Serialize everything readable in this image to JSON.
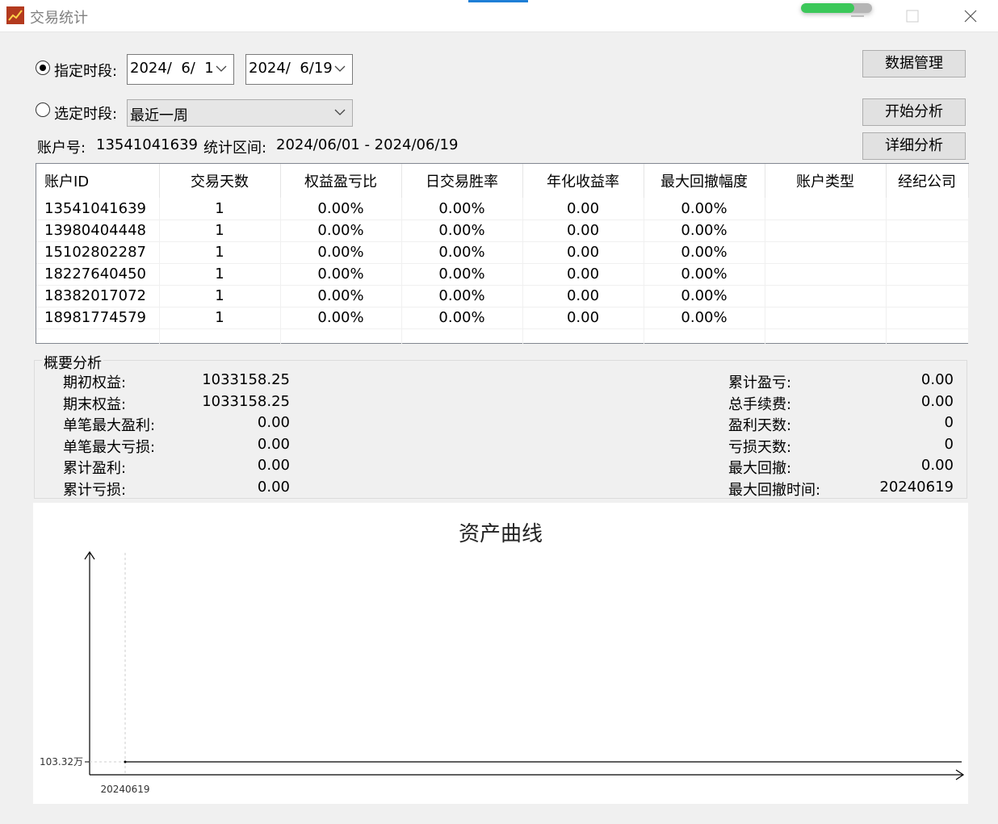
{
  "window": {
    "title": "交易统计",
    "progress_fraction": 0.75,
    "accent_color": "#3cc85a"
  },
  "period": {
    "specified_label": "指定时段:",
    "specified_checked": true,
    "start_date": "2024/  6/  1",
    "end_date": "2024/  6/19",
    "select_label": "选定时段:",
    "select_checked": false,
    "select_value": "最近一周"
  },
  "buttons": {
    "data_manage": "数据管理",
    "start_analysis": "开始分析",
    "detail_analysis": "详细分析"
  },
  "info": {
    "account_label": "账户号:",
    "account_value": "13541041639",
    "range_label": "统计区间:",
    "range_value": "2024/06/01 - 2024/06/19"
  },
  "table": {
    "headers": [
      "账户ID",
      "交易天数",
      "权益盈亏比",
      "日交易胜率",
      "年化收益率",
      "最大回撤幅度",
      "账户类型",
      "经纪公司"
    ],
    "rows": [
      [
        "13541041639",
        "1",
        "0.00%",
        "0.00%",
        "0.00",
        "0.00%",
        "",
        ""
      ],
      [
        "13980404448",
        "1",
        "0.00%",
        "0.00%",
        "0.00",
        "0.00%",
        "",
        ""
      ],
      [
        "15102802287",
        "1",
        "0.00%",
        "0.00%",
        "0.00",
        "0.00%",
        "",
        ""
      ],
      [
        "18227640450",
        "1",
        "0.00%",
        "0.00%",
        "0.00",
        "0.00%",
        "",
        ""
      ],
      [
        "18382017072",
        "1",
        "0.00%",
        "0.00%",
        "0.00",
        "0.00%",
        "",
        ""
      ],
      [
        "18981774579",
        "1",
        "0.00%",
        "0.00%",
        "0.00",
        "0.00%",
        "",
        ""
      ]
    ]
  },
  "summary": {
    "title": "概要分析",
    "left": [
      {
        "label": "期初权益:",
        "value": "1033158.25"
      },
      {
        "label": "期末权益:",
        "value": "1033158.25"
      },
      {
        "label": "单笔最大盈利:",
        "value": "0.00"
      },
      {
        "label": "单笔最大亏损:",
        "value": "0.00"
      },
      {
        "label": "累计盈利:",
        "value": "0.00"
      },
      {
        "label": "累计亏损:",
        "value": "0.00"
      }
    ],
    "right": [
      {
        "label": "累计盈亏:",
        "value": "0.00"
      },
      {
        "label": "总手续费:",
        "value": "0.00"
      },
      {
        "label": "盈利天数:",
        "value": "0"
      },
      {
        "label": "亏损天数:",
        "value": "0"
      },
      {
        "label": "最大回撤:",
        "value": "0.00"
      },
      {
        "label": "最大回撤时间:",
        "value": "20240619"
      }
    ]
  },
  "chart_data": {
    "type": "line",
    "title": "资产曲线",
    "x": [
      "20240619"
    ],
    "series": [
      {
        "values": [
          103.32
        ]
      }
    ],
    "y_tick_labels": [
      "103.32万"
    ],
    "x_tick_labels": [
      "20240619"
    ],
    "xlabel": "",
    "ylabel": "",
    "grid": false,
    "line_color": "#000000"
  }
}
